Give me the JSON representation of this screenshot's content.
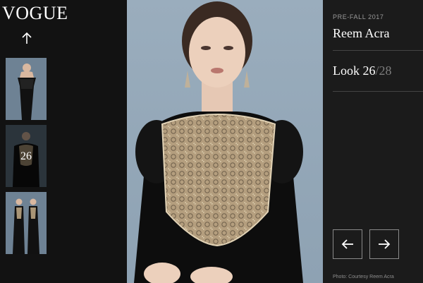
{
  "brand": {
    "logo": "VOGUE"
  },
  "thumbnails": [
    {
      "number": ""
    },
    {
      "number": "26"
    },
    {
      "number": ""
    }
  ],
  "info": {
    "collection": "PRE-FALL 2017",
    "designer": "Reem Acra",
    "look_label": "Look",
    "look_current": "26",
    "look_total": "/28"
  },
  "credit": "Photo: Courtesy Reem Acra",
  "colors": {
    "photo_background": "#93a7b8",
    "panel_background": "#1b1b1b",
    "dress": "#0d0d0d",
    "embellishment": "#a99576"
  },
  "icons": {
    "up": "arrow-up-icon",
    "prev": "arrow-left-icon",
    "next": "arrow-right-icon"
  }
}
